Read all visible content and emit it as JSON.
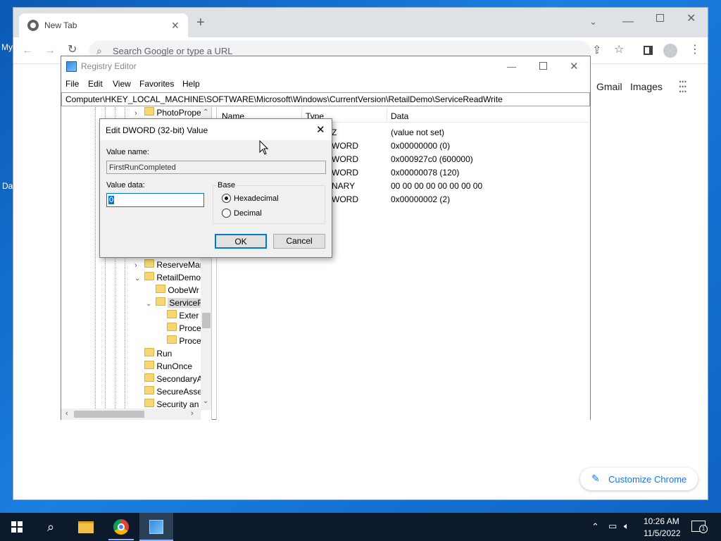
{
  "desktop": {
    "icon_labels": [
      "My",
      "Da"
    ]
  },
  "chrome": {
    "tab_title": "New Tab",
    "omnibox_placeholder": "Search Google or type a URL",
    "links": {
      "gmail": "Gmail",
      "images": "Images"
    },
    "customize_label": "Customize Chrome"
  },
  "regedit": {
    "title": "Registry Editor",
    "menu": [
      "File",
      "Edit",
      "View",
      "Favorites",
      "Help"
    ],
    "address": "Computer\\HKEY_LOCAL_MACHINE\\SOFTWARE\\Microsoft\\Windows\\CurrentVersion\\RetailDemo\\ServiceReadWrite",
    "tree": [
      {
        "label": "PhotoPropert",
        "level": 0,
        "expander": ">"
      },
      {
        "label": "ReserveMan",
        "level": 0,
        "expander": ">"
      },
      {
        "label": "RetailDemo",
        "level": 0,
        "expander": "v"
      },
      {
        "label": "OobeWr",
        "level": 1,
        "expander": ""
      },
      {
        "label": "ServiceR",
        "level": 1,
        "expander": "v",
        "selected": true
      },
      {
        "label": "Exter",
        "level": 2,
        "expander": ""
      },
      {
        "label": "Proce",
        "level": 2,
        "expander": ""
      },
      {
        "label": "Proce",
        "level": 2,
        "expander": ""
      },
      {
        "label": "Run",
        "level": 0,
        "expander": ""
      },
      {
        "label": "RunOnce",
        "level": 0,
        "expander": ""
      },
      {
        "label": "SecondaryA",
        "level": 0,
        "expander": ""
      },
      {
        "label": "SecureAsse",
        "level": 0,
        "expander": ""
      },
      {
        "label": "Security an",
        "level": 0,
        "expander": ""
      }
    ],
    "columns": {
      "name": "Name",
      "type": "Type",
      "data": "Data"
    },
    "rows": [
      {
        "type": "Z",
        "data": "(value not set)"
      },
      {
        "type": "WORD",
        "data": "0x00000000 (0)"
      },
      {
        "type": "WORD",
        "data": "0x000927c0 (600000)"
      },
      {
        "type": "WORD",
        "data": "0x00000078 (120)"
      },
      {
        "type": "NARY",
        "data": "00 00 00 00 00 00 00 00"
      },
      {
        "type": "WORD",
        "data": "0x00000002 (2)"
      }
    ]
  },
  "dialog": {
    "title": "Edit DWORD (32-bit) Value",
    "value_name_label": "Value name:",
    "value_name": "FirstRunCompleted",
    "value_data_label": "Value data:",
    "value_data": "0",
    "base_label": "Base",
    "hex_label": "Hexadecimal",
    "dec_label": "Decimal",
    "ok_label": "OK",
    "cancel_label": "Cancel"
  },
  "taskbar": {
    "time": "10:26 AM",
    "date": "11/5/2022",
    "notification_count": "1"
  }
}
